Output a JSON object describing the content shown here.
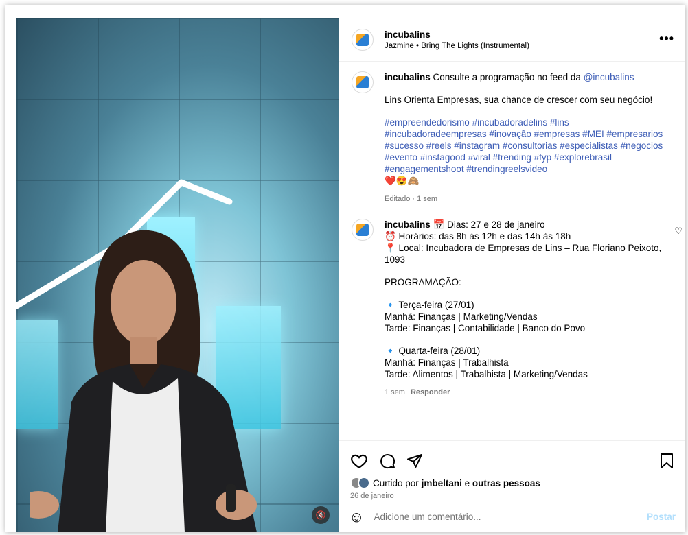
{
  "post": {
    "username": "incubalins",
    "audio": "Jazmine • Bring The Lights (Instrumental)",
    "more_icon": "more-horizontal-icon"
  },
  "caption": {
    "username": "incubalins",
    "text": "Consulte a programação no feed da",
    "mention": "@incubalins",
    "line2": "Lins Orienta Empresas, sua chance de crescer com seu negócio!",
    "hashtags": "#empreendedorismo #incubadoradelins #lins #incubadoradeempresas #inovação #empresas #MEI #empresarios #sucesso #reels #instagram #consultorias #especialistas #negocios #evento #instagood #viral #trending #fyp #explorebrasil #engagementshoot #trendingreelsvideo",
    "emojis": "❤️😍🙈",
    "meta": "Editado · 1 sem"
  },
  "comment": {
    "username": "incubalins",
    "line1": "📅 Dias: 27 e 28 de janeiro",
    "line2": "⏰ Horários: das 8h às 12h e das 14h às 18h",
    "line3": "📍 Local: Incubadora de Empresas de Lins – Rua Floriano Peixoto, 1093",
    "heading": "PROGRAMAÇÃO:",
    "day1": "🔹 Terça-feira (27/01)",
    "day1_morning": "Manhã: Finanças | Marketing/Vendas",
    "day1_afternoon": "Tarde: Finanças | Contabilidade | Banco do Povo",
    "day2": "🔹 Quarta-feira (28/01)",
    "day2_morning": "Manhã: Finanças | Trabalhista",
    "day2_afternoon": "Tarde: Alimentos | Trabalhista | Marketing/Vendas",
    "time": "1 sem",
    "reply": "Responder"
  },
  "actions": {
    "liked_prefix": "Curtido por",
    "liked_user": "jmbeltani",
    "liked_join": "e",
    "liked_others": "outras pessoas",
    "date": "26 de janeiro"
  },
  "add_comment": {
    "placeholder": "Adicione um comentário...",
    "post_label": "Postar"
  }
}
